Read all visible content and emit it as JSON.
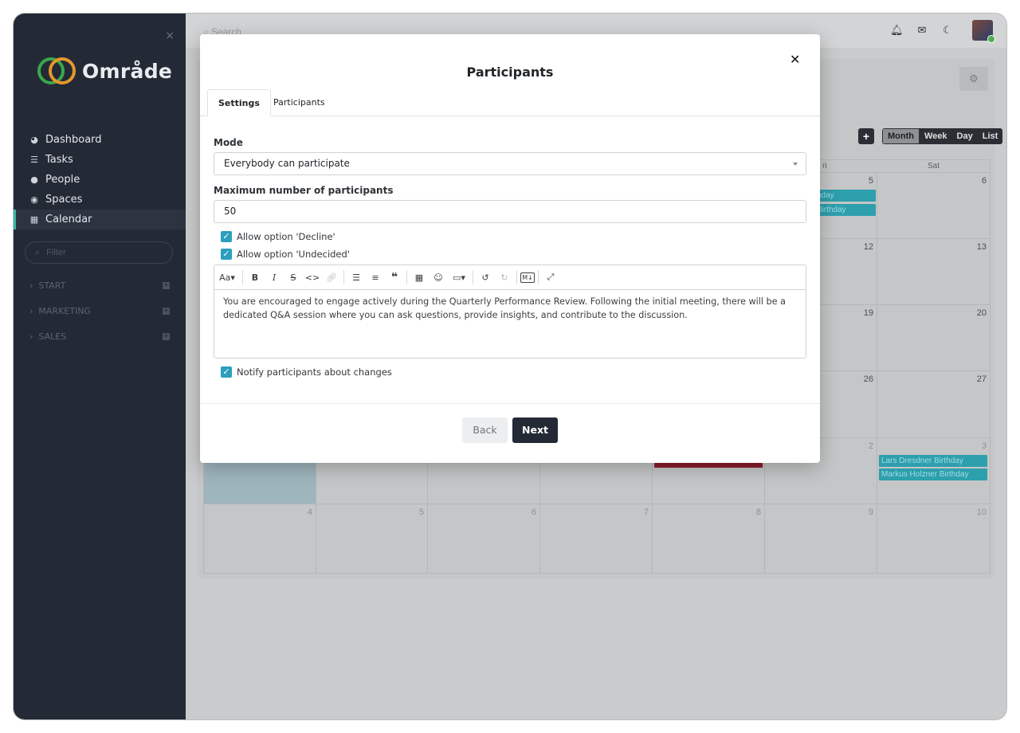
{
  "sidebar": {
    "close_icon": "×",
    "logo_text": "Område",
    "items": [
      {
        "label": "Dashboard",
        "icon": "dashboard-icon",
        "glyph": "◕"
      },
      {
        "label": "Tasks",
        "icon": "tasks-icon",
        "glyph": "☰"
      },
      {
        "label": "People",
        "icon": "people-icon",
        "glyph": "👥"
      },
      {
        "label": "Spaces",
        "icon": "spaces-icon",
        "glyph": "◉"
      },
      {
        "label": "Calendar",
        "icon": "calendar-icon",
        "glyph": "▦",
        "active": true
      }
    ],
    "filter_placeholder": "Filter",
    "groups": [
      {
        "label": "START"
      },
      {
        "label": "MARKETING"
      },
      {
        "label": "SALES"
      }
    ]
  },
  "topbar": {
    "search_placeholder": "Search",
    "icons": [
      "bell-icon",
      "mail-icon",
      "moon-icon"
    ]
  },
  "calendar": {
    "views": [
      "Month",
      "Week",
      "Day",
      "List"
    ],
    "active_view": "Month",
    "day_headers": {
      "fri": "ri",
      "sat": "Sat"
    },
    "visible_dates": {
      "row1": [
        "5",
        "6"
      ],
      "row2": [
        "12",
        "13"
      ],
      "row3": [
        "19",
        "20"
      ],
      "row4": [
        "26",
        "27"
      ],
      "row5": [
        "2",
        "3"
      ],
      "row6": [
        "4",
        "5",
        "6",
        "7",
        "8",
        "9",
        "10"
      ]
    },
    "events": {
      "fri_row1_a": "hday",
      "fri_row1_b": "Birthday",
      "sat_row5_a": "Lars Dresdner Birthday",
      "sat_row5_b": "Markus Holzner Birthday"
    }
  },
  "modal": {
    "title": "Participants",
    "close_icon": "✕",
    "tabs": [
      "Settings",
      "Participants"
    ],
    "active_tab": "Settings",
    "mode_label": "Mode",
    "mode_value": "Everybody can participate",
    "max_label": "Maximum number of participants",
    "max_value": "50",
    "checks": {
      "decline": "Allow option 'Decline'",
      "undecided": "Allow option 'Undecided'",
      "notify": "Notify participants about changes"
    },
    "toolbar": {
      "heading": "Aa",
      "bold": "B",
      "italic": "I",
      "strike": "S",
      "code": "<>",
      "markdown": "M↓"
    },
    "editor_text": "You are encouraged to engage actively during the Quarterly Performance Review. Following the initial meeting, there will be a dedicated Q&A session where you can ask questions, provide insights, and contribute to the discussion.",
    "back_label": "Back",
    "next_label": "Next"
  }
}
